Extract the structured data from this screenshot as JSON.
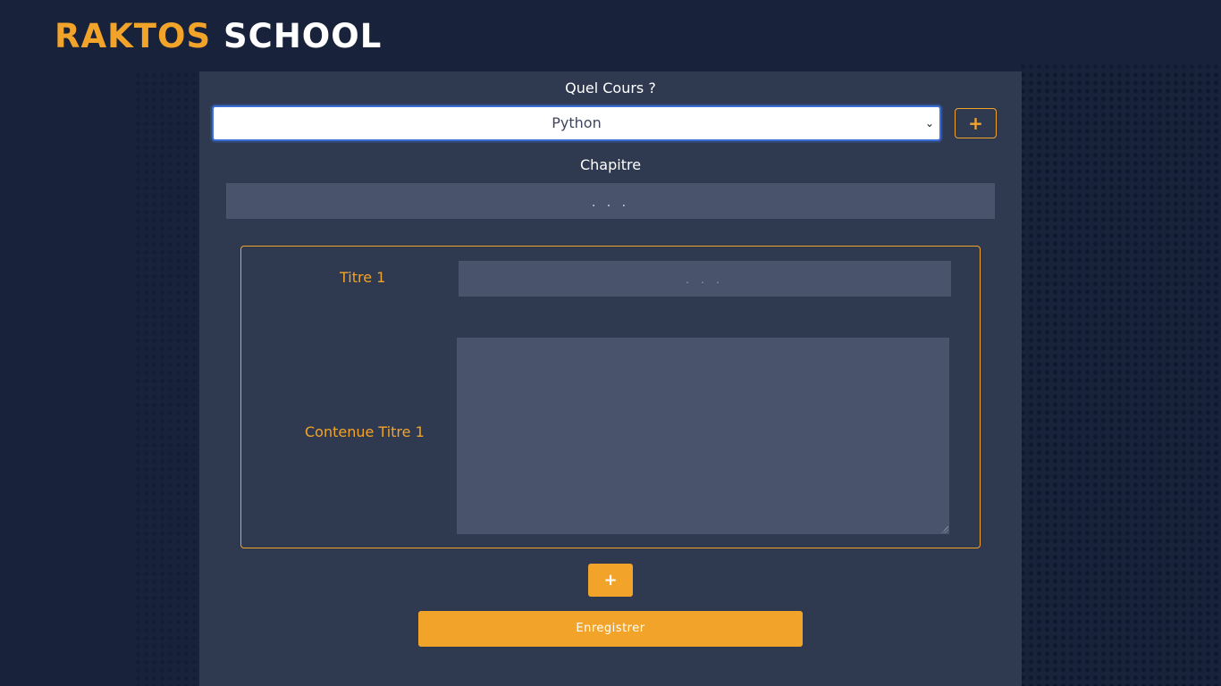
{
  "brand": {
    "part1": "RAKTOS",
    "part2": "SCHOOL",
    "accent_color": "#f2a42a"
  },
  "form": {
    "course_label": "Quel Cours ?",
    "course_selected": "Python",
    "add_course_label": "+",
    "chapter_label": "Chapitre",
    "chapter_placeholder": ". . .",
    "section": {
      "title_label": "Titre 1",
      "title_placeholder": ". . .",
      "content_label": "Contenue Titre 1",
      "content_value": ""
    },
    "add_section_label": "+",
    "save_label": "Enregistrer"
  }
}
